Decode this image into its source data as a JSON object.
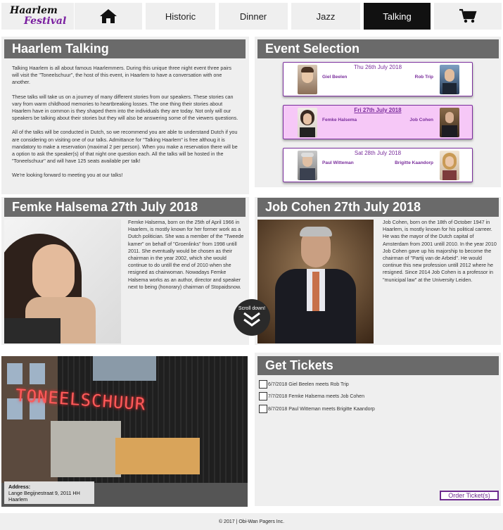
{
  "nav": {
    "logo_line1": "Haarlem",
    "logo_line2": "Festival",
    "tabs": [
      "Historic",
      "Dinner",
      "Jazz",
      "Talking"
    ],
    "active_tab": "Talking"
  },
  "intro": {
    "title": "Haarlem Talking",
    "paragraphs": [
      "Talking Haarlem is all about famous Haarlemmers. During this unique three night event three pairs will visit the \"Toneelschuur\", the host of this event, in Haarlem to have a conversation with one another.",
      "These talks will take us on a journey of many different stories from our speakers. These stories can vary from warm childhood memories to heartbreaking losses. The one thing their stories about Haarlem have in common is they shaped them into the individuals they are today. Not only will our speakers be talking about their stories but they will also be answering some of the viewers questions.",
      "All of the talks will be conducted in Dutch, so we recommend you are able to understand Dutch if you are considering on visiting one of our talks. Admittance for \"Talking Haarlem\" is free althoug it is mandatory to make a reservation (maximal 2 per person). When you make a reservation there will be a option to ask the speaker(s) of that night one question each. All the talks will be hosted in the \"Toneelschuur\" and will have 125 seats available per talk!",
      "We're looking forward to meeting you at our talks!"
    ]
  },
  "events": {
    "title": "Event Selection",
    "items": [
      {
        "date": "Thu 26th July 2018",
        "left": "Giel Beelen",
        "right": "Rob Trip",
        "selected": false
      },
      {
        "date": "Fri 27th July 2018",
        "left": "Femke Halsema",
        "right": "Job Cohen",
        "selected": true
      },
      {
        "date": "Sat 28th July 2018",
        "left": "Paul Witteman",
        "right": "Brigitte Kaandorp",
        "selected": false
      }
    ]
  },
  "speaker1": {
    "title": "Femke Halsema 27th July 2018",
    "bio": "Femke Halsema, born on the 25th of April 1966 in Haarlem, is mostly known for her former work as a Dutch politician. She was a member of the \"Tweede kamer\" on behalf of \"Groenlinks\" from 1998 untill 2011. She eventually would be chosen as their chairman in the year 2002, which she would continue to do untill the end of 2010 when she resigned as chairwoman. Nowadays Femke Halsema works as an author, director and speaker next to being (honorary) chairman of Stopaidsnow."
  },
  "speaker2": {
    "title": "Job Cohen 27th July 2018",
    "bio": "Job Cohen, born on the 18th of October 1947 in Haarlem, is mostly known for his political carreer. He was the mayor of the Dutch capital of Amsterdam from 2001 untill 2010. In the year 2010 Job Cohen gave up his majorship to become the chairman of \"Partij van de Arbeid\". He would continue this new profession untill 2012 where he resigned. Since 2014 Job Cohen is a professor in \"municipal law\" at the University Leiden."
  },
  "scroll": {
    "label": "Scroll down!"
  },
  "venue": {
    "sign": "TONEELSCHUUR",
    "address_label": "Address:",
    "address": "Lange Begijnestraat 9, 2011 HH Haarlem"
  },
  "tickets": {
    "title": "Get Tickets",
    "items": [
      "6/7/2018 Giel Beelen meets Rob Trip",
      "7/7/2018 Femke Halsema meets Job Cohen",
      "8/7/2018 Paul Witteman meets Brigitte Kaandorp"
    ],
    "order_label": "Order Ticket(s)"
  },
  "footer": {
    "text": "© 2017 | Obi-Wan Pagers Inc."
  },
  "icons": {
    "home": "home-icon",
    "cart": "cart-icon",
    "scroll": "chevron-double-down-icon"
  },
  "colors": {
    "accent": "#7a2e9c",
    "header_bar": "#6a6a6a",
    "active_tab": "#111111",
    "selected_event": "#f6c8f7"
  }
}
